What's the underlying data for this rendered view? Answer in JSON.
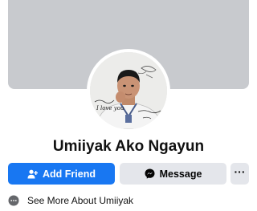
{
  "profile": {
    "name": "Umiiyak Ako Ngayun"
  },
  "avatar_overlay": {
    "handwriting_text": "I love you"
  },
  "actions": {
    "add_friend_label": "Add Friend",
    "message_label": "Message",
    "more_label": "···"
  },
  "about": {
    "label": "See More About Umiiyak"
  },
  "colors": {
    "primary": "#1877f2",
    "secondary_button": "#e4e6eb",
    "cover": "#c8cace"
  },
  "icons": {
    "add_friend": "person-add-icon",
    "message": "messenger-icon",
    "more": "more-dots-icon",
    "about": "info-icon"
  }
}
